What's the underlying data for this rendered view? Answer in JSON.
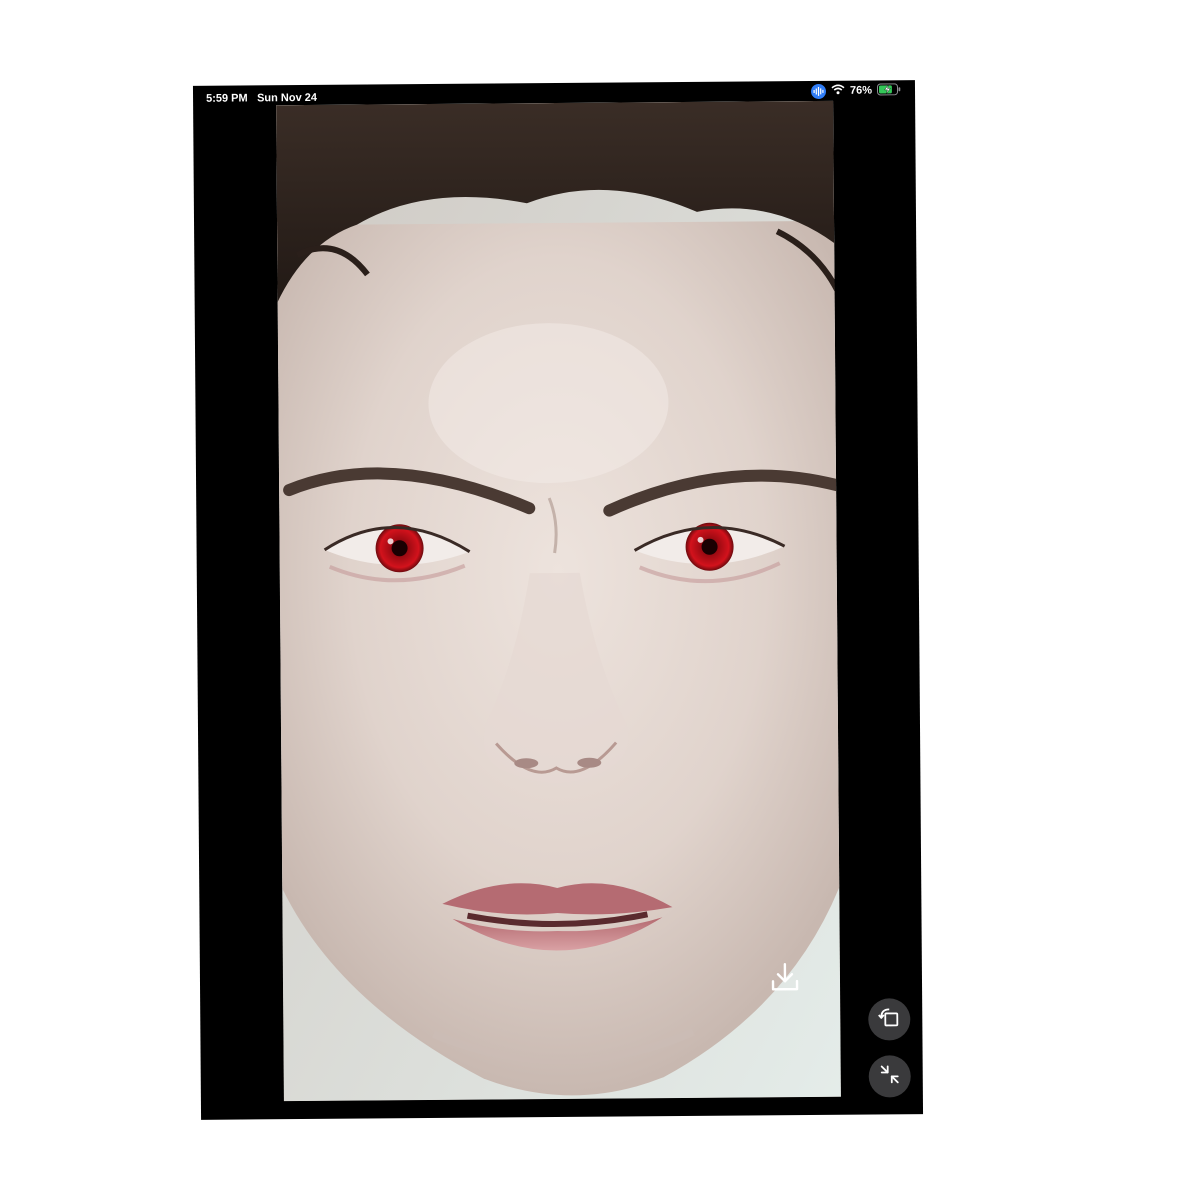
{
  "status_bar": {
    "time": "5:59 PM",
    "date": "Sun Nov 24",
    "battery_percent": "76%",
    "icons": [
      "microphone-active-icon",
      "wifi-icon",
      "battery-charging-icon"
    ],
    "battery_level": 0.76,
    "accent_color": "#2f7cf6"
  },
  "viewer": {
    "image_subject": "portrait-photo",
    "buttons": [
      "download-icon",
      "rotate-icon",
      "exit-fullscreen-icon"
    ],
    "eye_color": "#c4101a"
  }
}
